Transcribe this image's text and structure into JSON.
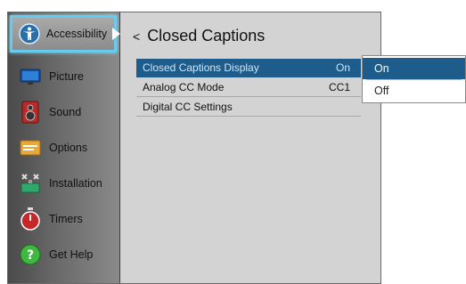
{
  "sidebar": {
    "items": [
      {
        "label": "Accessibility",
        "icon": "accessibility-icon"
      },
      {
        "label": "Picture",
        "icon": "picture-icon"
      },
      {
        "label": "Sound",
        "icon": "speaker-icon"
      },
      {
        "label": "Options",
        "icon": "options-icon"
      },
      {
        "label": "Installation",
        "icon": "installation-icon"
      },
      {
        "label": "Timers",
        "icon": "timer-icon"
      },
      {
        "label": "Get Help",
        "icon": "help-icon"
      }
    ],
    "active_index": 0
  },
  "content": {
    "back_symbol": "<",
    "title": "Closed Captions",
    "rows": [
      {
        "label": "Closed Captions Display",
        "value": "On"
      },
      {
        "label": "Analog CC Mode",
        "value": "CC1"
      },
      {
        "label": "Digital CC Settings",
        "value": ""
      }
    ]
  },
  "popup": {
    "options": [
      "On",
      "Off"
    ],
    "selected": "On"
  },
  "colors": {
    "highlight": "#1e5c8c",
    "focus_border": "#66ccee",
    "background": "#d3d3d3"
  }
}
